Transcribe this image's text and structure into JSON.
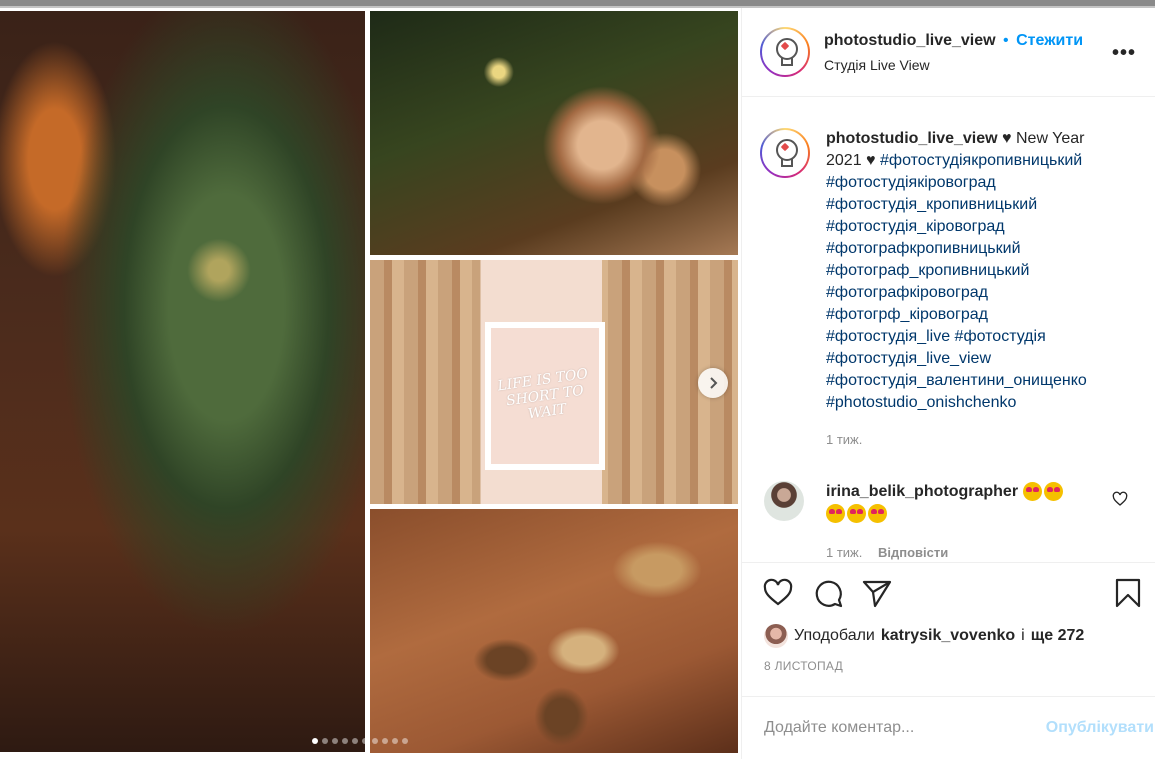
{
  "post": {
    "username": "photostudio_live_view",
    "follow_label": "Стежити",
    "separator": "•",
    "location": "Студія Live View",
    "more_label": "•••"
  },
  "caption": {
    "username": "photostudio_live_view",
    "text_line1": "♥ New Year",
    "text_line2": "2021 ♥",
    "first_tag": "#фотостудіякропивницький",
    "tags": [
      "#фотостудіякіровоград",
      "#фотостудія_кропивницький",
      "#фотостудія_кіровоград",
      "#фотографкропивницький",
      "#фотограф_кропивницький",
      "#фотографкіровоград",
      "#фотогрф_кіровоград"
    ],
    "tag_pair": [
      "#фотостудія_live",
      "#фотостудія"
    ],
    "tags_tail": [
      "#фотостудія_live_view",
      "#фотостудія_валентини_онищенко",
      "#photostudio_onishchenko"
    ],
    "time": "1 тиж."
  },
  "comment": {
    "username": "irina_belik_photographer",
    "emoji_line1_count": 2,
    "emoji_line2_count": 3,
    "emoji_name": "heart-eyes-emoji",
    "time": "1 тиж.",
    "reply_label": "Відповісти"
  },
  "media": {
    "frame_text": "LIFE IS TOO SHORT TO WAIT",
    "carousel_total": 10,
    "carousel_active": 1
  },
  "likes": {
    "prefix": "Уподобали",
    "user": "katrysik_vovenko",
    "middle": "і",
    "more": "ще 272"
  },
  "date": "8 ЛИСТОПАД",
  "add_comment": {
    "placeholder": "Додайте коментар...",
    "publish_label": "Опублікувати"
  },
  "icons": [
    "heart-icon",
    "comment-icon",
    "share-icon",
    "save-icon",
    "more-icon",
    "chevron-right-icon"
  ],
  "colors": {
    "accent": "#0095f6",
    "publish_disabled": "#b2dffc",
    "hashtag": "#00376b"
  }
}
